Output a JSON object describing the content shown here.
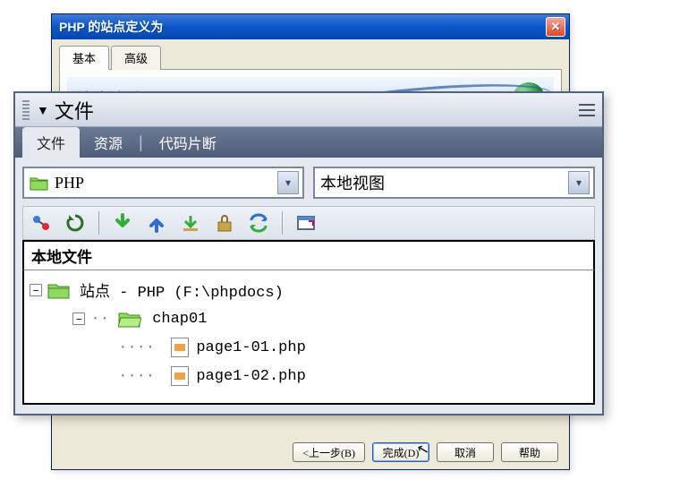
{
  "dialog": {
    "title": "PHP 的站点定义为",
    "tabs": {
      "basic": "基本",
      "advanced": "高级"
    },
    "banner_label": "站点定义",
    "buttons": {
      "prev": "<上一步(B)",
      "finish": "完成(D)",
      "cancel": "取消",
      "help": "帮助"
    }
  },
  "panel": {
    "header": "文件",
    "tabs": {
      "files": "文件",
      "assets": "资源",
      "snippets": "代码片断"
    },
    "site_combo": "PHP",
    "view_combo": "本地视图",
    "list_header": "本地文件",
    "tree": {
      "root": "站点 - PHP (F:\\phpdocs)",
      "folder1": "chap01",
      "file1": "page1-01.php",
      "file2": "page1-02.php"
    },
    "icons": {
      "connect": "connect-icon",
      "refresh": "refresh-icon",
      "down": "download-icon",
      "up": "upload-icon",
      "checkout": "checkout-icon",
      "checkin": "checkin-icon",
      "sync": "sync-icon",
      "expand": "expand-icon"
    }
  }
}
